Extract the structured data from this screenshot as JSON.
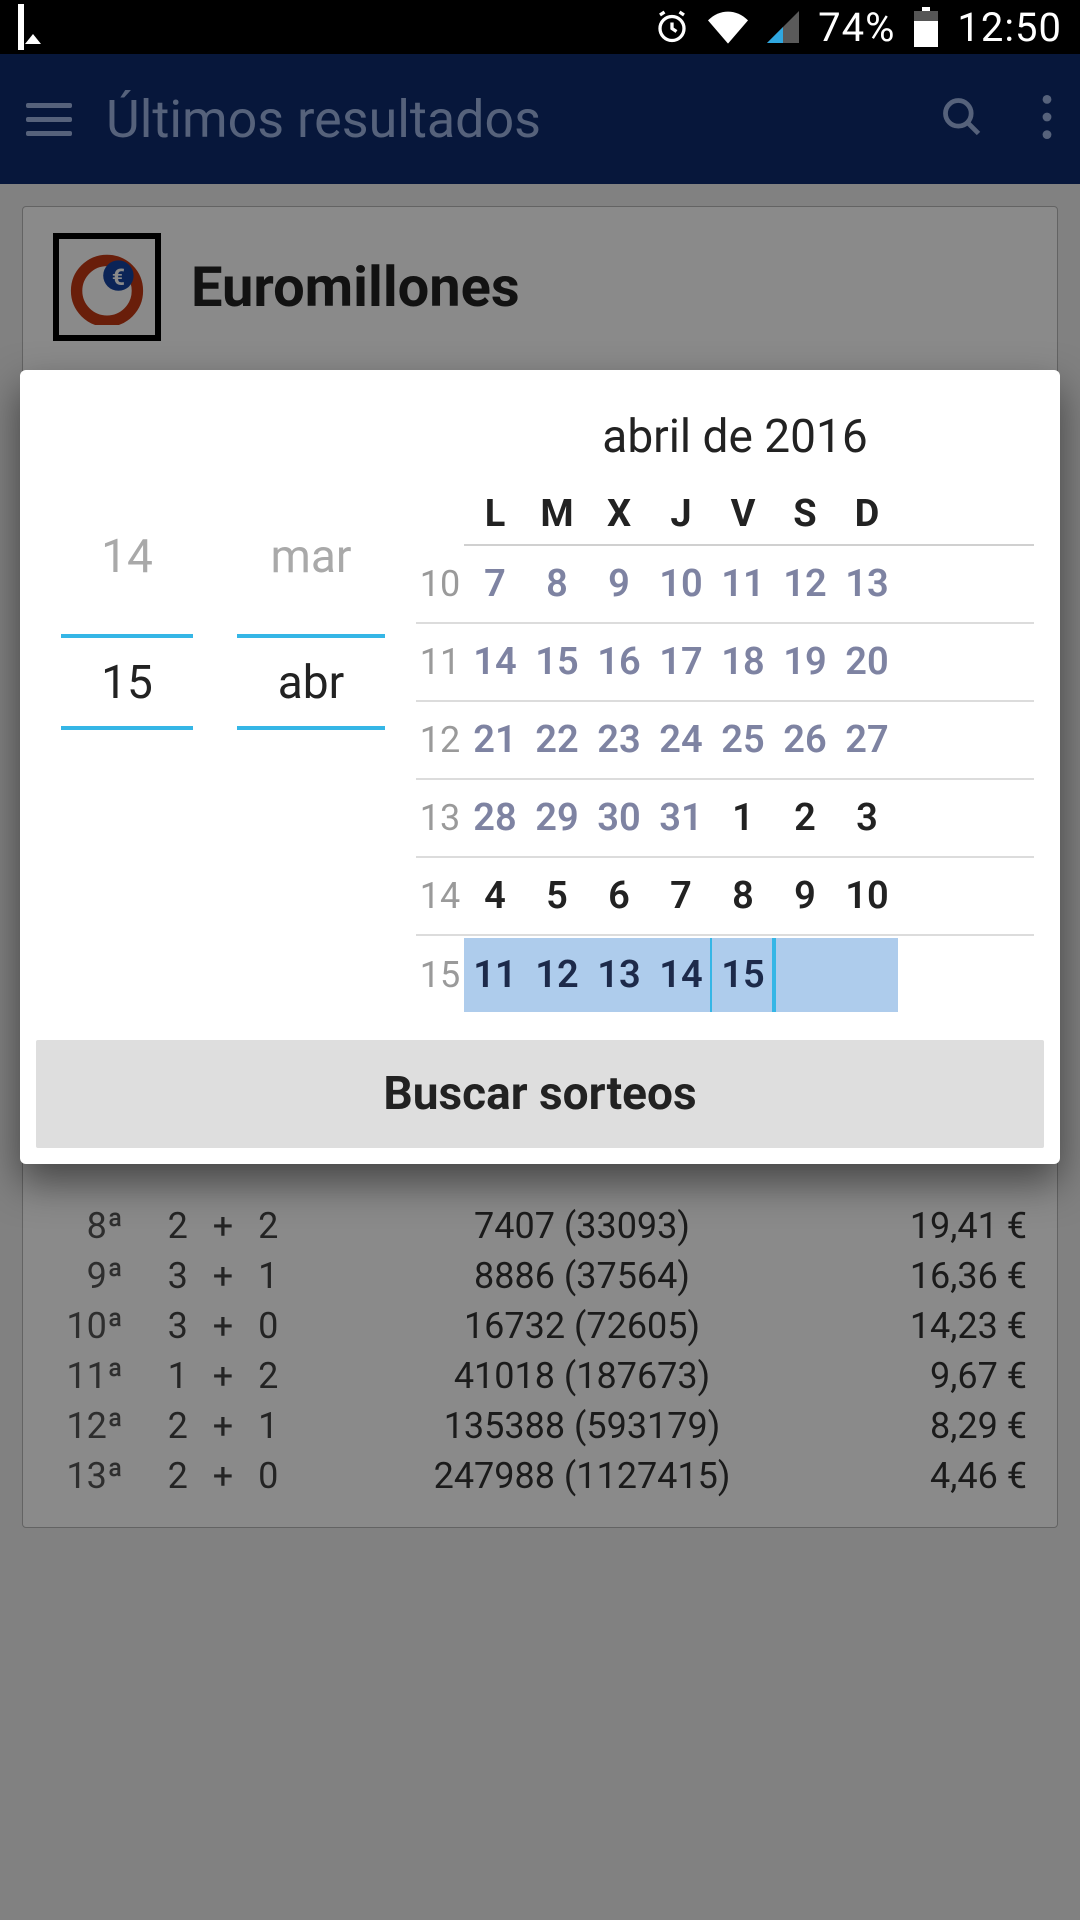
{
  "statusbar": {
    "battery_percent": "74%",
    "time": "12:50"
  },
  "toolbar": {
    "title": "Últimos resultados"
  },
  "lottery": {
    "name": "Euromillones"
  },
  "dialog": {
    "day_prev": "14",
    "month_prev": "mar",
    "day_sel": "15",
    "month_sel": "abr",
    "title": "abril de 2016",
    "dow": [
      "L",
      "M",
      "X",
      "J",
      "V",
      "S",
      "D"
    ],
    "weeks": [
      {
        "num": "10",
        "days": [
          {
            "n": "7"
          },
          {
            "n": "8"
          },
          {
            "n": "9"
          },
          {
            "n": "10"
          },
          {
            "n": "11"
          },
          {
            "n": "12"
          },
          {
            "n": "13"
          }
        ]
      },
      {
        "num": "11",
        "days": [
          {
            "n": "14"
          },
          {
            "n": "15"
          },
          {
            "n": "16"
          },
          {
            "n": "17"
          },
          {
            "n": "18"
          },
          {
            "n": "19"
          },
          {
            "n": "20"
          }
        ]
      },
      {
        "num": "12",
        "days": [
          {
            "n": "21"
          },
          {
            "n": "22"
          },
          {
            "n": "23"
          },
          {
            "n": "24"
          },
          {
            "n": "25"
          },
          {
            "n": "26"
          },
          {
            "n": "27"
          }
        ]
      },
      {
        "num": "13",
        "days": [
          {
            "n": "28"
          },
          {
            "n": "29"
          },
          {
            "n": "30"
          },
          {
            "n": "31"
          },
          {
            "n": "1",
            "in": true
          },
          {
            "n": "2",
            "in": true
          },
          {
            "n": "3",
            "in": true
          }
        ]
      },
      {
        "num": "14",
        "days": [
          {
            "n": "4",
            "in": true
          },
          {
            "n": "5",
            "in": true
          },
          {
            "n": "6",
            "in": true
          },
          {
            "n": "7",
            "in": true
          },
          {
            "n": "8",
            "in": true
          },
          {
            "n": "9",
            "in": true
          },
          {
            "n": "10",
            "in": true
          }
        ]
      },
      {
        "num": "15",
        "days": [
          {
            "n": "11",
            "in": true,
            "sel": true
          },
          {
            "n": "12",
            "in": true,
            "sel": true
          },
          {
            "n": "13",
            "in": true,
            "sel": true
          },
          {
            "n": "14",
            "in": true,
            "sel": true,
            "today": true
          },
          {
            "n": "15",
            "in": true,
            "sel": true,
            "today": true
          },
          {
            "n": "",
            "sel": true
          },
          {
            "n": "",
            "sel": true
          }
        ]
      }
    ],
    "action_label": "Buscar sorteos"
  },
  "results": [
    {
      "cat": "8ª",
      "combo": "2 + 2",
      "winners": "7407 (33093)",
      "prize": "19,41 €"
    },
    {
      "cat": "9ª",
      "combo": "3 + 1",
      "winners": "8886 (37564)",
      "prize": "16,36 €"
    },
    {
      "cat": "10ª",
      "combo": "3 + 0",
      "winners": "16732 (72605)",
      "prize": "14,23 €"
    },
    {
      "cat": "11ª",
      "combo": "1 + 2",
      "winners": "41018 (187673)",
      "prize": "9,67 €"
    },
    {
      "cat": "12ª",
      "combo": "2 + 1",
      "winners": "135388 (593179)",
      "prize": "8,29 €"
    },
    {
      "cat": "13ª",
      "combo": "2 + 0",
      "winners": "247988 (1127415)",
      "prize": "4,46 €"
    }
  ]
}
